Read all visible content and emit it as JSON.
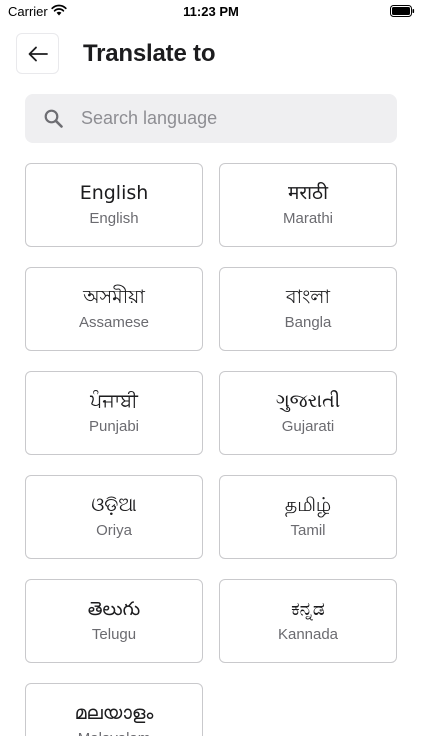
{
  "status_bar": {
    "carrier": "Carrier",
    "time": "11:23 PM"
  },
  "header": {
    "title": "Translate to",
    "back_icon": "arrow-left-icon"
  },
  "search": {
    "placeholder": "Search language",
    "value": "",
    "icon": "search-icon"
  },
  "languages": [
    {
      "native": "English",
      "english": "English"
    },
    {
      "native": "मराठी",
      "english": "Marathi"
    },
    {
      "native": "অসমীয়া",
      "english": "Assamese"
    },
    {
      "native": "বাংলা",
      "english": "Bangla"
    },
    {
      "native": "ਪੰਜਾਬੀ",
      "english": "Punjabi"
    },
    {
      "native": "ગુજરાતી",
      "english": "Gujarati"
    },
    {
      "native": "ଓଡ଼ିଆ",
      "english": "Oriya"
    },
    {
      "native": "தமிழ்",
      "english": "Tamil"
    },
    {
      "native": "తెలుగు",
      "english": "Telugu"
    },
    {
      "native": "ಕನ್ನಡ",
      "english": "Kannada"
    },
    {
      "native": "മലയാളം",
      "english": "Malayalam"
    }
  ],
  "colors": {
    "card_border": "#c9c9cc",
    "search_bg": "#efeff1",
    "secondary_text": "#6b6b70"
  }
}
